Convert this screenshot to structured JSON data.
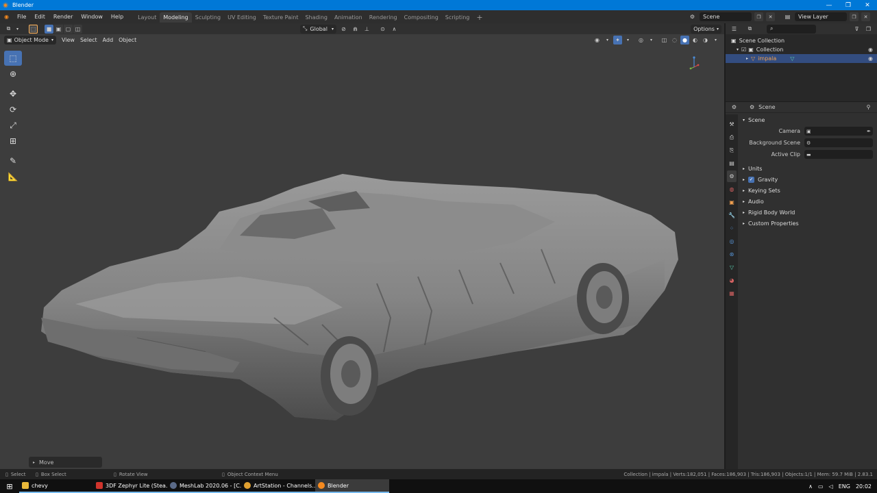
{
  "window": {
    "title": "Blender",
    "controls": [
      "—",
      "❐",
      "✕"
    ]
  },
  "menu": [
    "File",
    "Edit",
    "Render",
    "Window",
    "Help"
  ],
  "workspace_tabs": [
    {
      "label": "Layout",
      "active": false
    },
    {
      "label": "Modeling",
      "active": true
    },
    {
      "label": "Sculpting",
      "active": false
    },
    {
      "label": "UV Editing",
      "active": false
    },
    {
      "label": "Texture Paint",
      "active": false
    },
    {
      "label": "Shading",
      "active": false
    },
    {
      "label": "Animation",
      "active": false
    },
    {
      "label": "Rendering",
      "active": false
    },
    {
      "label": "Compositing",
      "active": false
    },
    {
      "label": "Scripting",
      "active": false
    }
  ],
  "topbar_right": {
    "scene": "Scene",
    "view_layer": "View Layer"
  },
  "viewport_header": {
    "transform_orientation": "Global",
    "options_label": "Options",
    "mode": "Object Mode",
    "menus": [
      "View",
      "Select",
      "Add",
      "Object"
    ]
  },
  "redo_panel": {
    "label": "Move"
  },
  "outliner": {
    "rows": [
      {
        "label": "Scene Collection",
        "indent": 0,
        "selected": false
      },
      {
        "label": "Collection",
        "indent": 1,
        "selected": false
      },
      {
        "label": "impala",
        "indent": 2,
        "selected": true
      }
    ]
  },
  "properties": {
    "header_title": "Scene",
    "panel_title": "Scene",
    "fields": [
      {
        "label": "Camera",
        "value": ""
      },
      {
        "label": "Background Scene",
        "value": ""
      },
      {
        "label": "Active Clip",
        "value": ""
      }
    ],
    "sections": [
      "Units",
      "Gravity",
      "Keying Sets",
      "Audio",
      "Rigid Body World",
      "Custom Properties"
    ],
    "gravity_checked": true
  },
  "statusbar": {
    "select": "Select",
    "box_select": "Box Select",
    "rotate_view": "Rotate View",
    "context_menu": "Object Context Menu",
    "stats": "Collection | impala | Verts:182,051 | Faces:186,903 | Tris:186,903 | Objects:1/1 | Mem: 59.7 MiB | 2.83.1"
  },
  "taskbar": {
    "items": [
      {
        "label": "chevy",
        "color": "#e8b83a"
      },
      {
        "label": "3DF Zephyr Lite (Stea...",
        "color": "#d0342c"
      },
      {
        "label": "MeshLab 2020.06 - [C...",
        "color": "#5a6a88"
      },
      {
        "label": "ArtStation - Channels...",
        "color": "#e0a030"
      },
      {
        "label": "Blender",
        "color": "#f58a1f"
      }
    ],
    "language": "ENG",
    "time": "20:02"
  }
}
